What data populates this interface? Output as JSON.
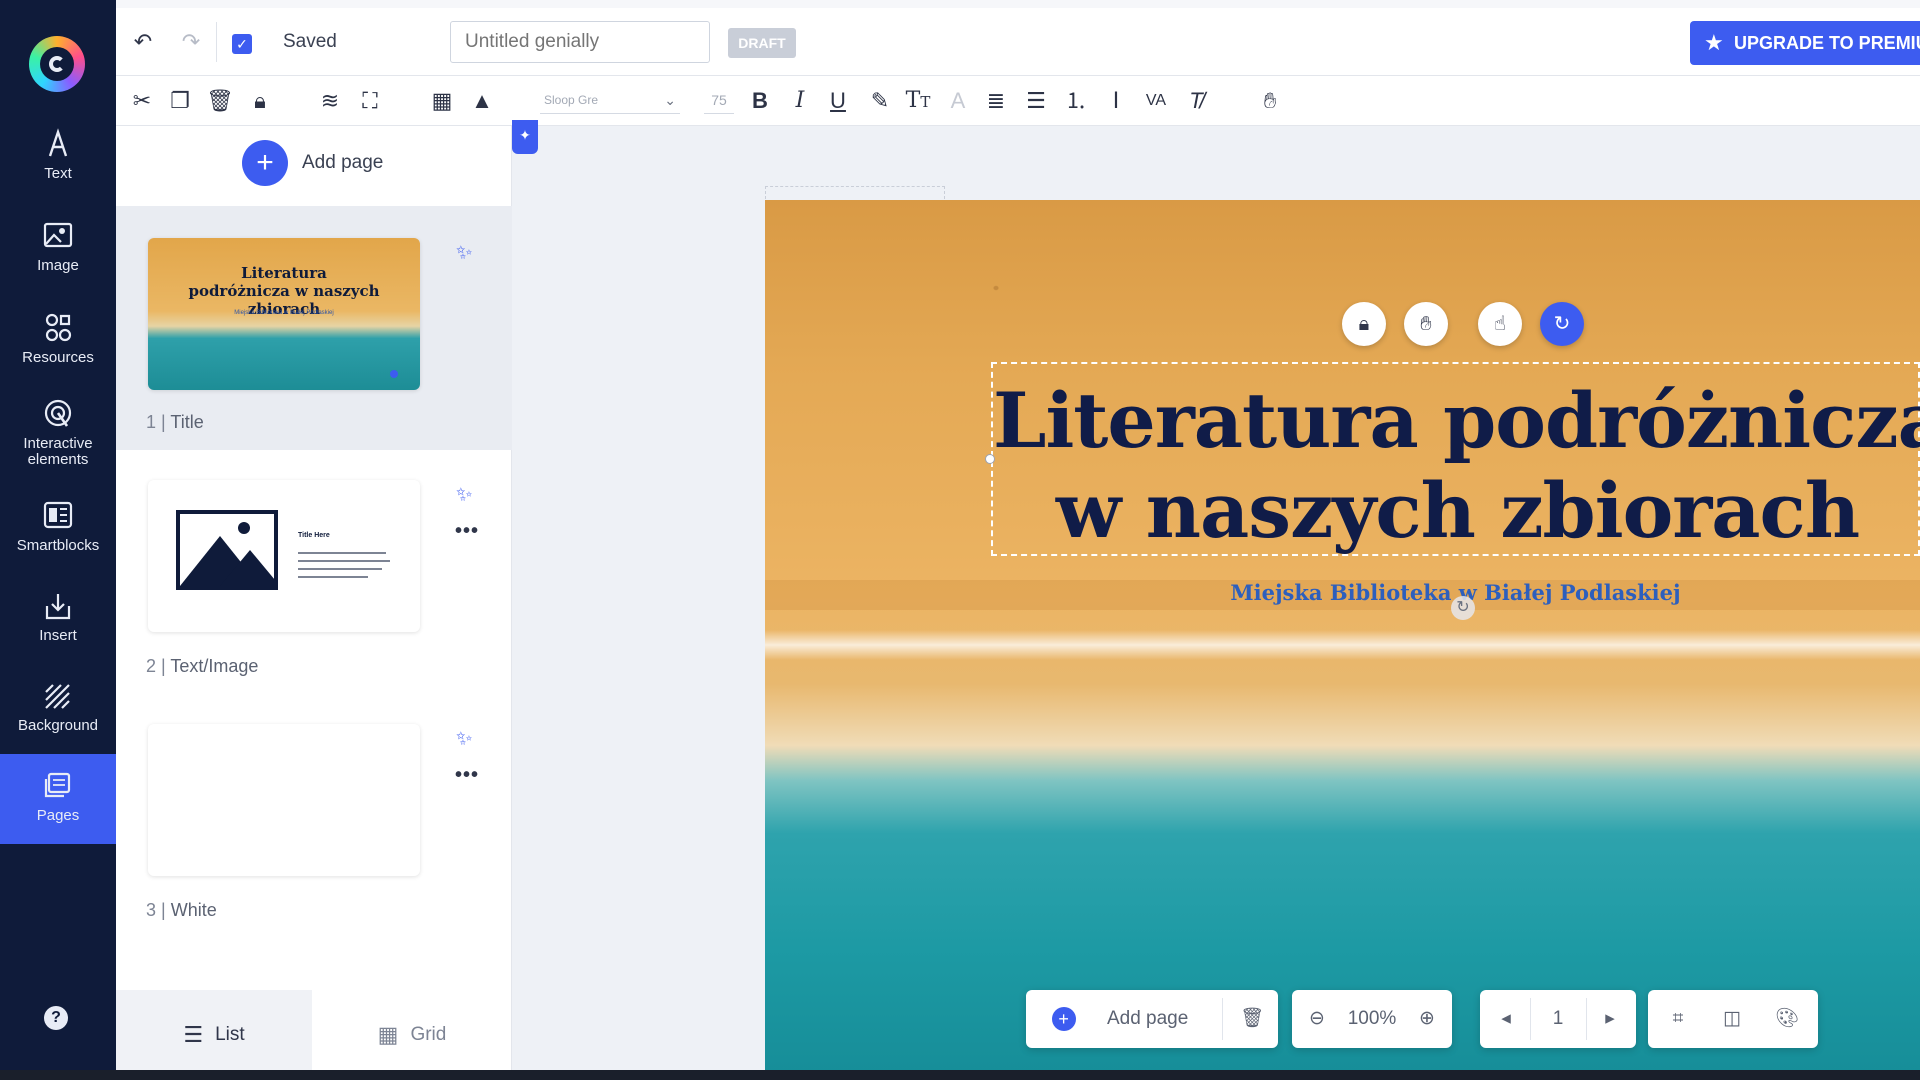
{
  "sidebar": {
    "items": [
      {
        "label": "Text",
        "icon": "text-icon"
      },
      {
        "label": "Image",
        "icon": "image-icon"
      },
      {
        "label": "Resources",
        "icon": "resources-icon"
      },
      {
        "label": "Interactive elements",
        "icon": "interactive-icon"
      },
      {
        "label": "Smartblocks",
        "icon": "smartblocks-icon"
      },
      {
        "label": "Insert",
        "icon": "insert-icon"
      },
      {
        "label": "Background",
        "icon": "background-icon"
      },
      {
        "label": "Pages",
        "icon": "pages-icon",
        "active": true
      }
    ],
    "help": "?"
  },
  "topbar": {
    "saved_label": "Saved",
    "title_placeholder": "Untitled genially",
    "draft_label": "DRAFT",
    "upgrade_label": "UPGRADE TO PREMIUM"
  },
  "formatbar": {
    "font_name": "Sloop Gre",
    "font_size": "75"
  },
  "pages_panel": {
    "add_page_label": "Add page",
    "pages": [
      {
        "number": "1",
        "name": "Title",
        "thumb_title": "Literatura podróżnicza w naszych zbiorach",
        "thumb_sub": "Miejska Biblioteka w Białej Podlaskiej"
      },
      {
        "number": "2",
        "name": "Text/Image",
        "thumb_title": "Title Here"
      },
      {
        "number": "3",
        "name": "White"
      }
    ],
    "list_label": "List",
    "grid_label": "Grid"
  },
  "canvas": {
    "title_line1": "Literatura podróżnicza",
    "title_line2": "w naszych zbiorach",
    "subtitle": "Miejska Biblioteka w Białej Podlaskiej"
  },
  "controls": {
    "add_page_label": "Add page",
    "zoom": "100%",
    "page_number": "1"
  },
  "colors": {
    "sidebar_bg": "#0f1b3a",
    "accent": "#3d5cf0",
    "title_color": "#101c48",
    "subtitle_color": "#2d5fbd"
  }
}
